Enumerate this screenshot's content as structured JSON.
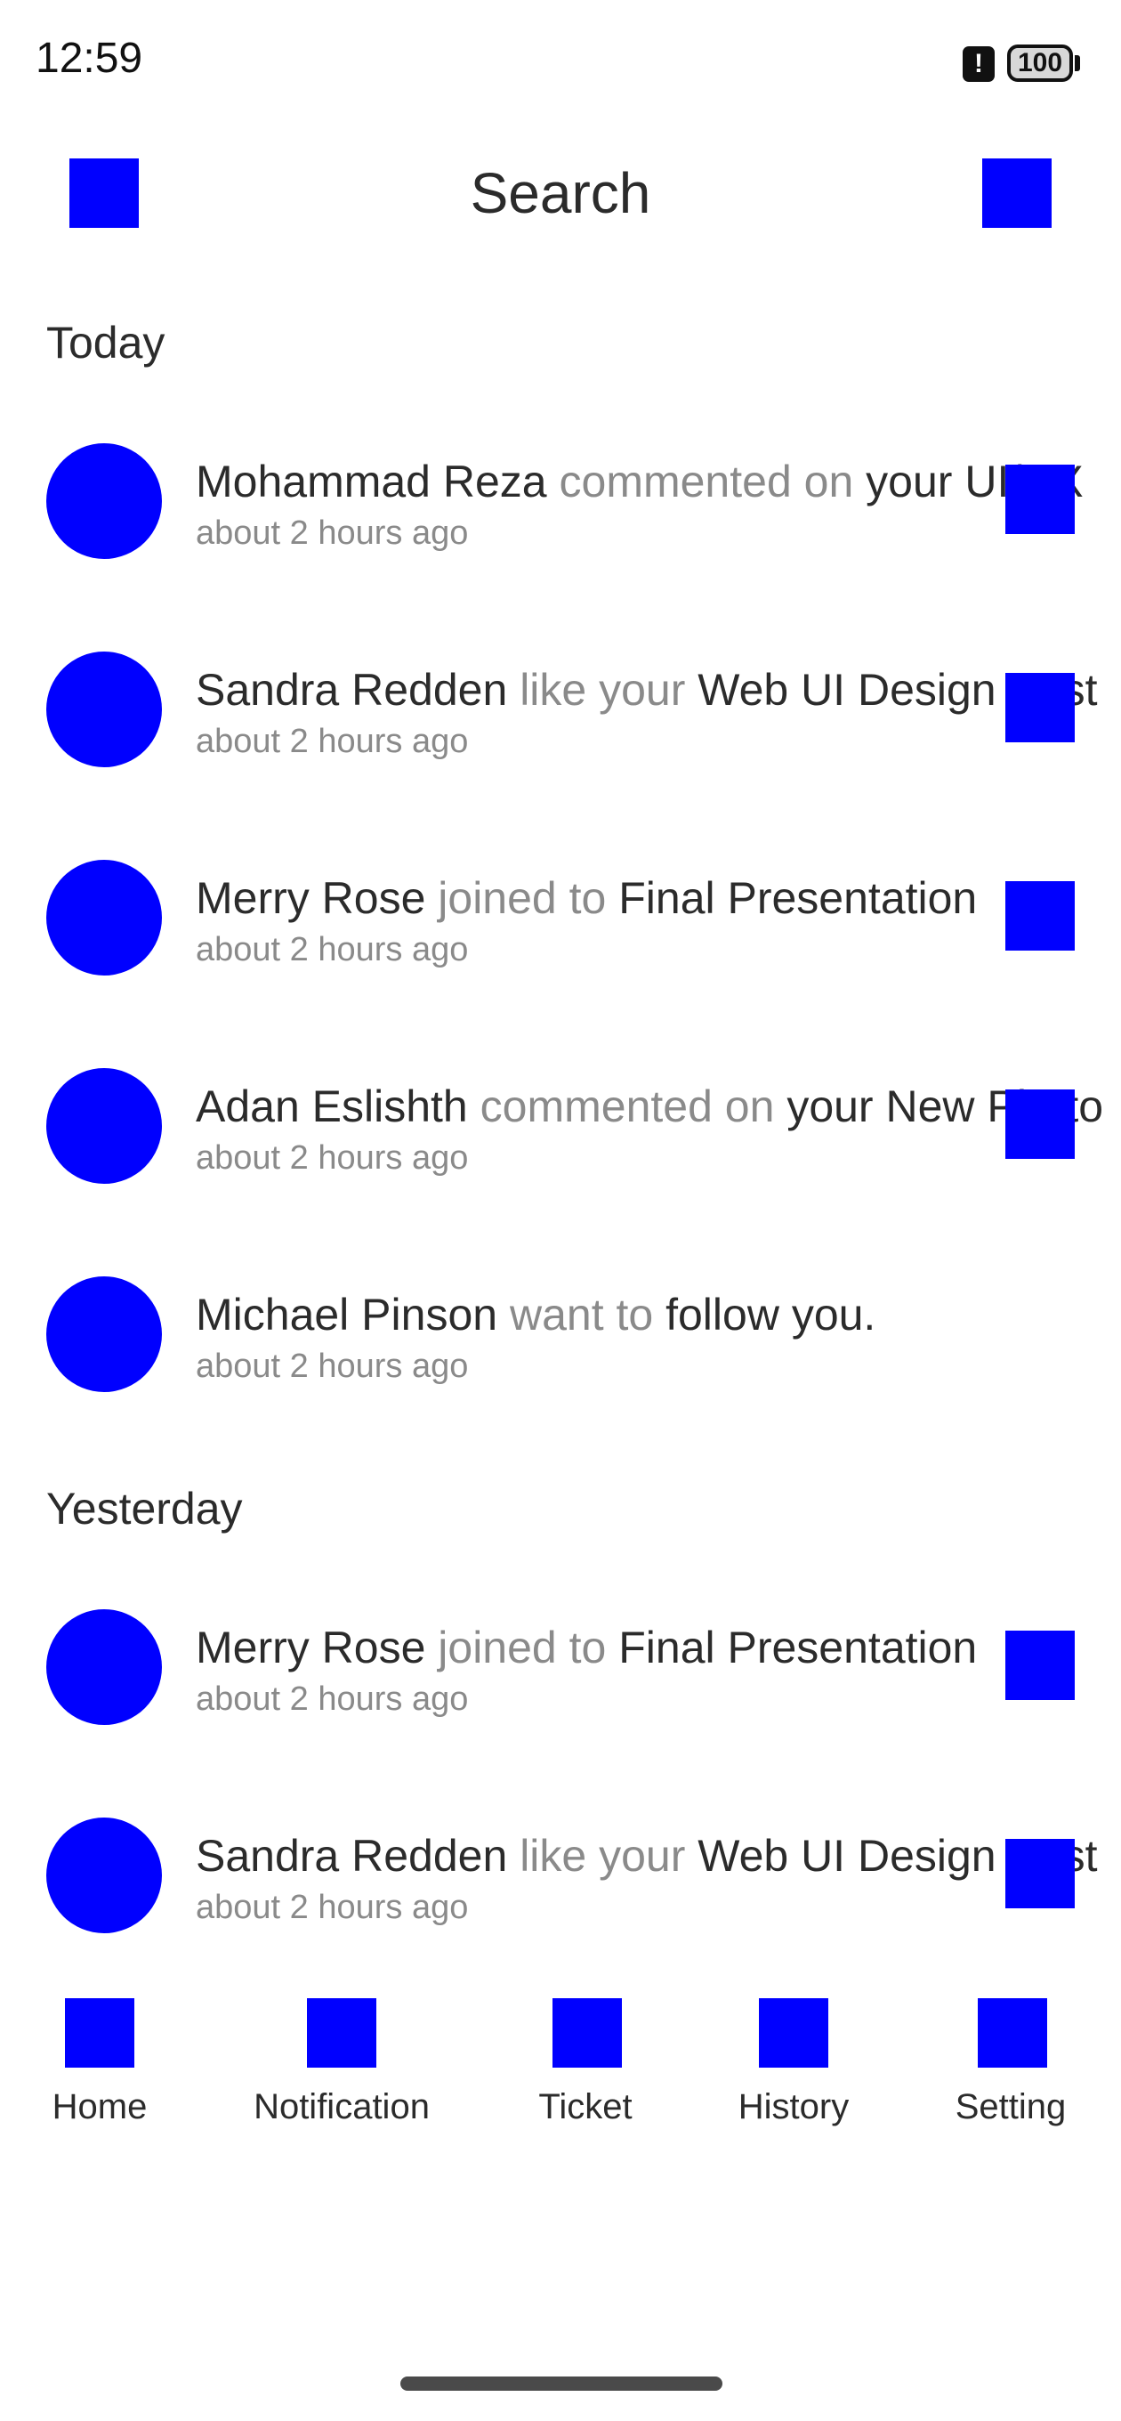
{
  "status_bar": {
    "time": "12:59",
    "battery": "100"
  },
  "header": {
    "title": "Search",
    "left_icon": "square-icon",
    "right_icon": "square-icon"
  },
  "sections": [
    {
      "title": "Today",
      "items": [
        {
          "name": "Mohammad Reza",
          "action": "commented on",
          "object": "your UI/UX",
          "time": "about 2 hours ago"
        },
        {
          "name": "Sandra Redden",
          "action": "like your",
          "object": "Web UI Design Post",
          "time": "about 2 hours ago"
        },
        {
          "name": "Merry Rose",
          "action": "joined to",
          "object": "Final Presentation",
          "time": "about 2 hours ago"
        },
        {
          "name": "Adan Eslishth",
          "action": "commented on",
          "object": "your New Photo",
          "time": "about 2 hours ago"
        },
        {
          "name": "Michael Pinson",
          "action": "want to",
          "object": "follow you.",
          "time": "about 2 hours ago"
        }
      ]
    },
    {
      "title": "Yesterday",
      "items": [
        {
          "name": "Merry Rose",
          "action": "joined to",
          "object": "Final Presentation",
          "time": "about 2 hours ago"
        },
        {
          "name": "Sandra Redden",
          "action": "like your",
          "object": "Web UI Design Post",
          "time": "about 2 hours ago"
        }
      ]
    }
  ],
  "bottom_nav": [
    {
      "label": "Home"
    },
    {
      "label": "Notification"
    },
    {
      "label": "Ticket"
    },
    {
      "label": "History"
    },
    {
      "label": "Setting"
    }
  ],
  "colors": {
    "accent": "#0000ff",
    "text": "#2b2b2b",
    "muted": "#8a8a8a"
  }
}
